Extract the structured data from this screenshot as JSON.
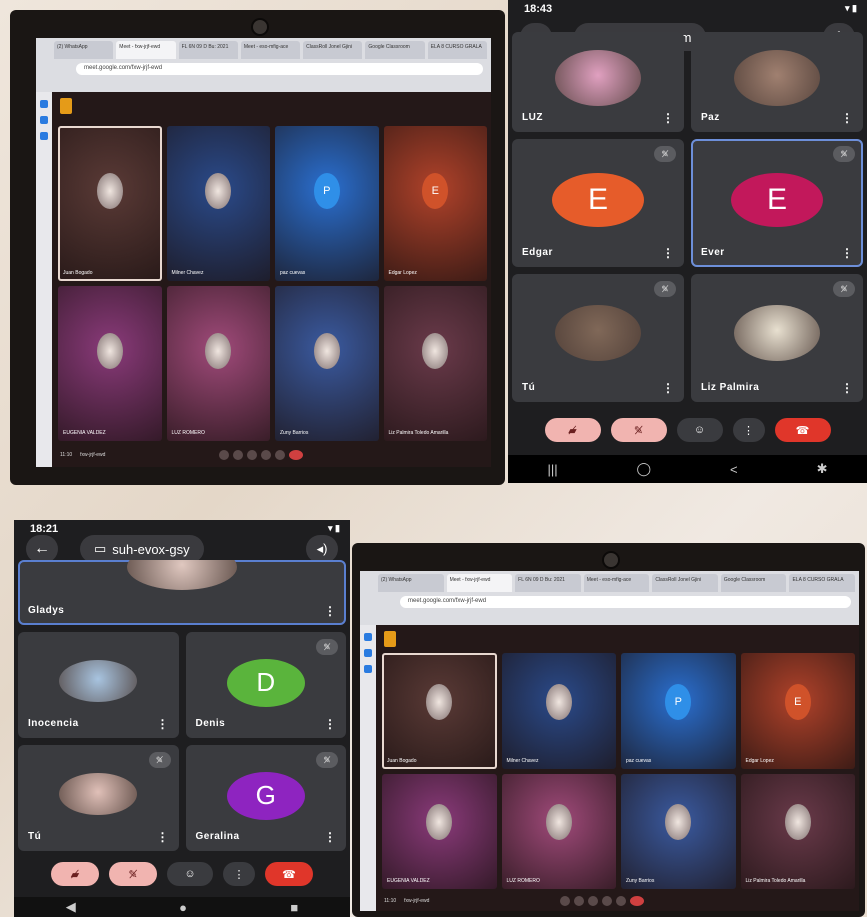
{
  "laptop1": {
    "tabs": [
      "(2) WhatsApp",
      "Meet - fxw-jrjf-ewd",
      "FL 6N 09 D Bu: 2021",
      "Meet - eso-mfig-ace",
      "ClassRoll Jonel Gjini",
      "Google Classroom",
      "ELA 8 CURSO GRALA"
    ],
    "url": "meet.google.com/fxw-jrjf-ewd",
    "tiles": [
      {
        "name": "Juan Bogado",
        "kind": "photo",
        "bg": "#5a3a36"
      },
      {
        "name": "Milner Chavez",
        "kind": "photo",
        "bg": "#2a4a8a"
      },
      {
        "name": "paz cuevas",
        "kind": "letter",
        "letter": "P",
        "bg": "#2a6fd0",
        "color": "#2f8fe8"
      },
      {
        "name": "Edgar Lopez",
        "kind": "letter",
        "letter": "E",
        "bg": "#b0422a",
        "color": "#d0522a"
      },
      {
        "name": "EUGENIA VALDEZ",
        "kind": "photo",
        "bg": "#8a3a7a"
      },
      {
        "name": "LUZ ROMERO",
        "kind": "photo",
        "bg": "#a04a7a"
      },
      {
        "name": "Zuny Barrios",
        "kind": "photo",
        "bg": "#3a5aa0"
      },
      {
        "name": "Liz Palmira Toledo Amarilla",
        "kind": "photo",
        "bg": "#6a3a4a"
      }
    ],
    "time": "11:10",
    "code": "fxw-jrjf-ewd"
  },
  "phone1": {
    "time": "18:43",
    "meeting_code": "mxn-mijy-dmm",
    "tiles": [
      {
        "name": "LUZ",
        "kind": "photo",
        "muted": false,
        "pic": "#e0a0c0"
      },
      {
        "name": "Paz",
        "kind": "photo",
        "muted": false,
        "pic": "#a08070"
      },
      {
        "name": "Edgar",
        "kind": "letter",
        "letter": "E",
        "color": "#e65c2a",
        "muted": true
      },
      {
        "name": "Ever",
        "kind": "letter",
        "letter": "E",
        "color": "#c2185b",
        "muted": true,
        "highlight": true
      },
      {
        "name": "Tú",
        "kind": "photo",
        "muted": true,
        "pic": "#806858"
      },
      {
        "name": "Liz Palmira",
        "kind": "photo",
        "muted": true,
        "pic": "#e8e0d0"
      }
    ],
    "nav": [
      "|||",
      "◯",
      "<",
      "✱"
    ]
  },
  "phone2": {
    "time": "18:21",
    "meeting_code": "suh-evox-gsy",
    "tiles": [
      {
        "name": "Gladys",
        "kind": "photo",
        "muted": false,
        "pic": "#e0c8c0",
        "wide": true
      },
      {
        "name": "Inocencia",
        "kind": "photo",
        "muted": false,
        "pic": "#a8c4e0"
      },
      {
        "name": "Denis",
        "kind": "letter",
        "letter": "D",
        "color": "#5ab43c",
        "muted": true
      },
      {
        "name": "Tú",
        "kind": "photo",
        "muted": true,
        "pic": "#e0c0b8"
      },
      {
        "name": "Geralina",
        "kind": "letter",
        "letter": "G",
        "color": "#8e24c0",
        "muted": true
      }
    ]
  },
  "laptop2": {
    "tabs": [
      "(2) WhatsApp",
      "Meet - fxw-jrjf-ewd",
      "FL 6N 09 D Bu: 2021",
      "Meet - eso-mfig-ace",
      "ClassRoll Jonel Gjini",
      "Google Classroom",
      "ELA 8 CURSO GRALA"
    ],
    "url": "meet.google.com/fxw-jrjf-ewd",
    "tiles": [
      {
        "name": "Juan Bogado",
        "kind": "photo",
        "bg": "#5a3a36"
      },
      {
        "name": "Milner Chavez",
        "kind": "photo",
        "bg": "#2a4a8a"
      },
      {
        "name": "paz cuevas",
        "kind": "letter",
        "letter": "P",
        "bg": "#2a6fd0",
        "color": "#2f8fe8"
      },
      {
        "name": "Edgar Lopez",
        "kind": "letter",
        "letter": "E",
        "bg": "#b0422a",
        "color": "#d0522a"
      },
      {
        "name": "EUGENIA VALDEZ",
        "kind": "photo",
        "bg": "#8a3a7a"
      },
      {
        "name": "LUZ ROMERO",
        "kind": "photo",
        "bg": "#a04a7a"
      },
      {
        "name": "Zuny Barrios",
        "kind": "photo",
        "bg": "#3a5aa0"
      },
      {
        "name": "Liz Palmira Toledo Amarilla",
        "kind": "photo",
        "bg": "#6a3a4a"
      }
    ],
    "time": "11:10",
    "code": "fxw-jrjf-ewd"
  }
}
